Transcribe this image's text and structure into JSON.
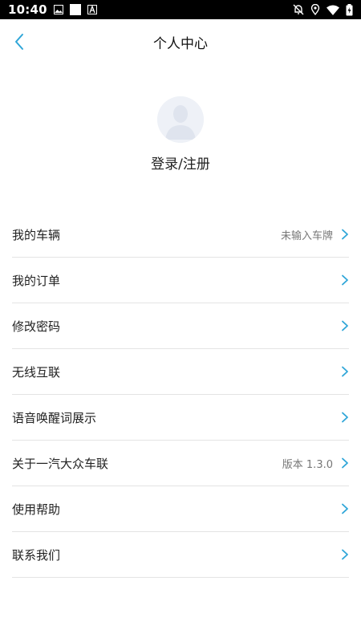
{
  "status_bar": {
    "time": "10:40",
    "left_icons": [
      "image-icon",
      "square-icon",
      "a-icon"
    ],
    "right_icons": [
      "notification-off-icon",
      "location-icon",
      "wifi-icon",
      "battery-icon"
    ]
  },
  "header": {
    "title": "个人中心",
    "back_icon": "chevron-left-icon"
  },
  "profile": {
    "login_label": "登录/注册"
  },
  "menu": {
    "items": [
      {
        "label": "我的车辆",
        "value": "未输入车牌"
      },
      {
        "label": "我的订单",
        "value": ""
      },
      {
        "label": "修改密码",
        "value": ""
      },
      {
        "label": "无线互联",
        "value": ""
      },
      {
        "label": "语音唤醒词展示",
        "value": ""
      },
      {
        "label": "关于一汽大众车联",
        "value": "版本 1.3.0"
      },
      {
        "label": "使用帮助",
        "value": ""
      },
      {
        "label": "联系我们",
        "value": ""
      }
    ]
  },
  "colors": {
    "accent": "#2fa6d8",
    "divider": "#e4e4e4",
    "status_bar_bg": "#000000"
  }
}
